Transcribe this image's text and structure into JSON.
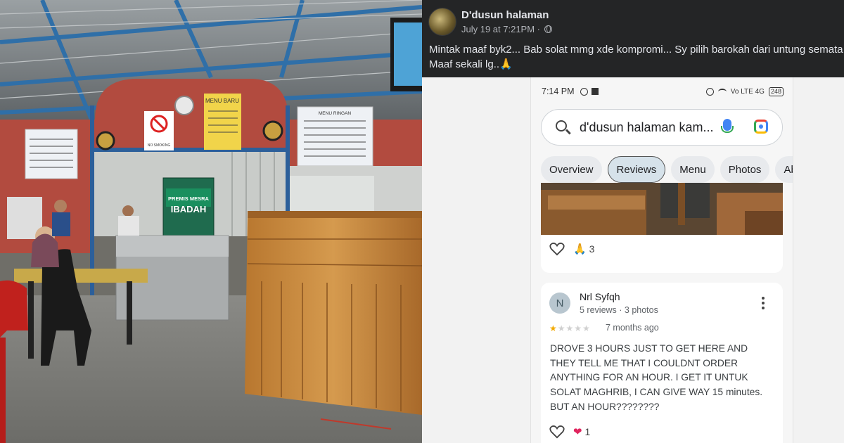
{
  "photo": {
    "signs": {
      "menu_baru": "MENU BARU",
      "menu_ringan": "MENU RINGAN",
      "no_smoking": "NO SMOKING",
      "premis_title": "PREMIS MESRA",
      "premis_ibadah": "IBADAH"
    }
  },
  "post": {
    "page_name": "D'dusun halaman",
    "timestamp": "July 19 at 7:21PM ·",
    "text_line1": "Mintak maaf byk2... Bab solat mmg xde kompromi... Sy pilih barokah dari untung semata",
    "text_line2": "Maaf sekali lg..🙏"
  },
  "phone": {
    "status_time": "7:14 PM",
    "status_net": "Vo LTE 4G",
    "battery": "248",
    "search_query": "d'dusun halaman kam...",
    "tabs": [
      "Overview",
      "Reviews",
      "Menu",
      "Photos",
      "Ab"
    ],
    "active_tab": "Reviews",
    "prev_card_reaction_count": "3",
    "review": {
      "avatar_letter": "N",
      "author": "Nrl Syfqh",
      "stats": "5 reviews · 3 photos",
      "rating": 1,
      "rating_max": 5,
      "date": "7 months ago",
      "body": "DROVE 3 HOURS JUST TO GET HERE AND THEY TELL ME THAT I COULDNT ORDER ANYTHING FOR AN HOUR. I GET IT UNTUK SOLAT MAGHRIB, I CAN GIVE WAY 15 minutes. BUT AN HOUR????????",
      "reaction_count": "1"
    }
  },
  "colors": {
    "fb_bg": "#242526",
    "accent_star": "#f2a900",
    "heart_red": "#e0245e"
  }
}
